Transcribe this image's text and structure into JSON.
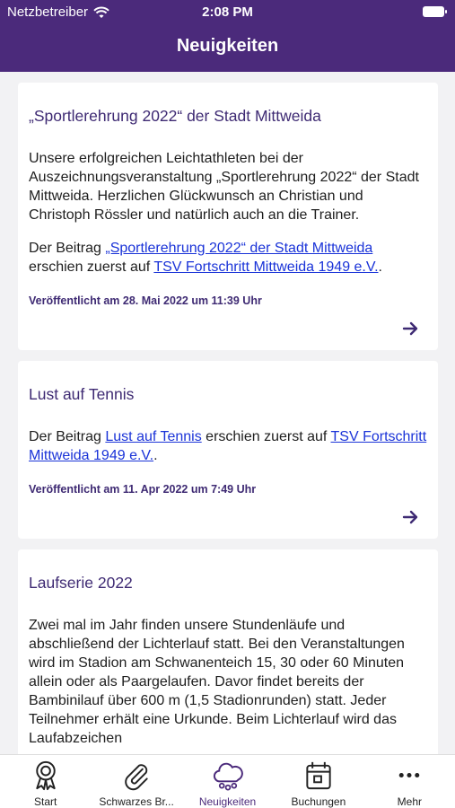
{
  "status": {
    "carrier": "Netzbetreiber",
    "time": "2:08 PM"
  },
  "nav": {
    "title": "Neuigkeiten"
  },
  "posts": [
    {
      "title": "„Sportlerehrung 2022“ der Stadt Mittweida",
      "body": "Unsere erfolgreichen Leichtathleten bei der Auszeichnungsveranstaltung „Sportlerehrung 2022“ der Stadt Mittweida. Herzlichen Glückwunsch an Christian und Christoph Rössler und natürlich auch an die Trainer.",
      "intro": "Der Beitrag ",
      "link": "„Sportlerehrung 2022“ der Stadt Mittweida",
      "middle": " erschien zuerst auf ",
      "site": "TSV Fortschritt Mittweida 1949 e.V.",
      "end": ".",
      "published": "Veröffentlicht am 28. Mai 2022 um 11:39 Uhr"
    },
    {
      "title": "Lust auf Tennis",
      "intro": "Der Beitrag ",
      "link": "Lust auf Tennis",
      "middle": " erschien zuerst auf ",
      "site": "TSV Fortschritt Mittweida 1949 e.V.",
      "end": ".",
      "published": "Veröffentlicht am 11. Apr 2022 um 7:49 Uhr"
    },
    {
      "title": "Laufserie 2022",
      "body": "Zwei mal im Jahr finden unsere Stundenläufe und abschließend der Lichterlauf statt. Bei den Veranstaltungen wird im Stadion am Schwanenteich 15, 30 oder 60 Minuten allein oder als Paargelaufen. Davor findet bereits der Bambinilauf über 600 m (1,5 Stadionrunden) statt. Jeder Teilnehmer erhält eine Urkunde. Beim Lichterlauf wird das Laufabzeichen"
    }
  ],
  "tabs": [
    {
      "label": "Start",
      "icon": "award-icon"
    },
    {
      "label": "Schwarzes Br...",
      "icon": "paperclip-icon"
    },
    {
      "label": "Neuigkeiten",
      "icon": "cloud-icon",
      "active": true
    },
    {
      "label": "Buchungen",
      "icon": "calendar-icon"
    },
    {
      "label": "Mehr",
      "icon": "more-icon"
    }
  ],
  "colors": {
    "primary": "#4b2a7b",
    "link": "#1a33d8",
    "background": "#f2f2f4"
  }
}
